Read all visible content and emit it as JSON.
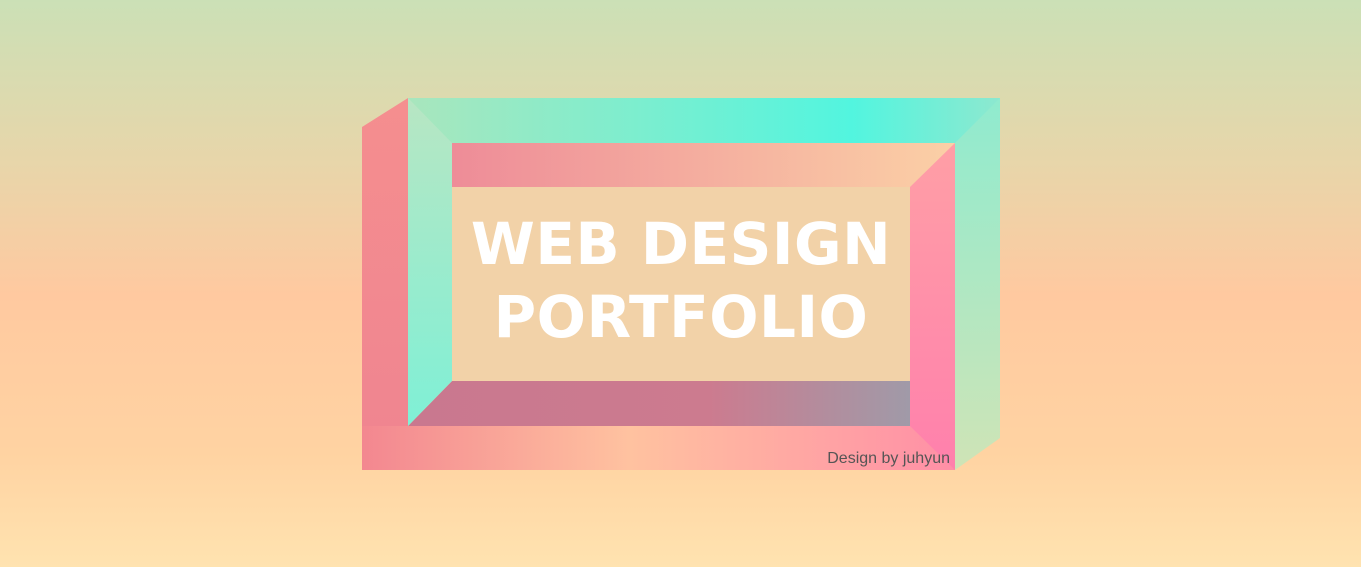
{
  "banner": {
    "title_line_1": "WEB DESIGN",
    "title_line_2": "PORTFOLIO",
    "credit": "Design by juhyun"
  },
  "colors": {
    "background_top": "#cbe0b6",
    "background_mid": "#ffc9a0",
    "background_bottom": "#ffe3b0",
    "frame_pink": "#f3878f",
    "frame_mint": "#52f5df",
    "frame_peach": "#ffbf9e",
    "frame_hot_pink": "#ff82ab",
    "inner_mauve": "#c9788f",
    "inner_panel": "#f2d2a8",
    "title_text": "#ffffff",
    "credit_text": "#555555"
  }
}
